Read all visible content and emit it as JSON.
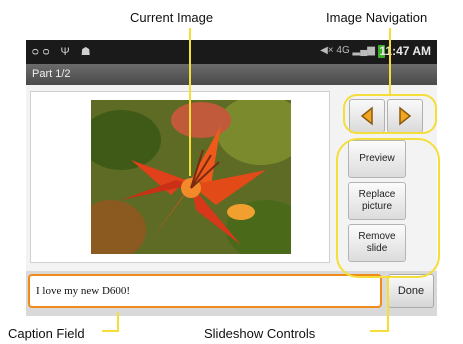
{
  "callouts": {
    "current_image": "Current Image",
    "image_navigation": "Image Navigation",
    "caption_field": "Caption Field",
    "slideshow_controls": "Slideshow Controls"
  },
  "status_bar": {
    "time": "11:47 AM",
    "left_icons": [
      "voicemail-icon",
      "usb-icon",
      "android-debug-icon"
    ],
    "right_icons": [
      "mute-icon",
      "4g-icon",
      "signal-icon",
      "battery-icon"
    ],
    "network": "4G"
  },
  "title": "Part 1/2",
  "image": {
    "subject": "red-lily-photo"
  },
  "nav": {
    "prev": "prev-slide-icon",
    "next": "next-slide-icon"
  },
  "controls": {
    "preview": "Preview",
    "replace": "Replace picture",
    "remove": "Remove slide"
  },
  "caption": {
    "value": "I love my new D600!"
  },
  "done_label": "Done",
  "colors": {
    "highlight": "#f5dd3a",
    "caption_border": "#f08a1a",
    "nav_arrow": "#e79a16"
  }
}
